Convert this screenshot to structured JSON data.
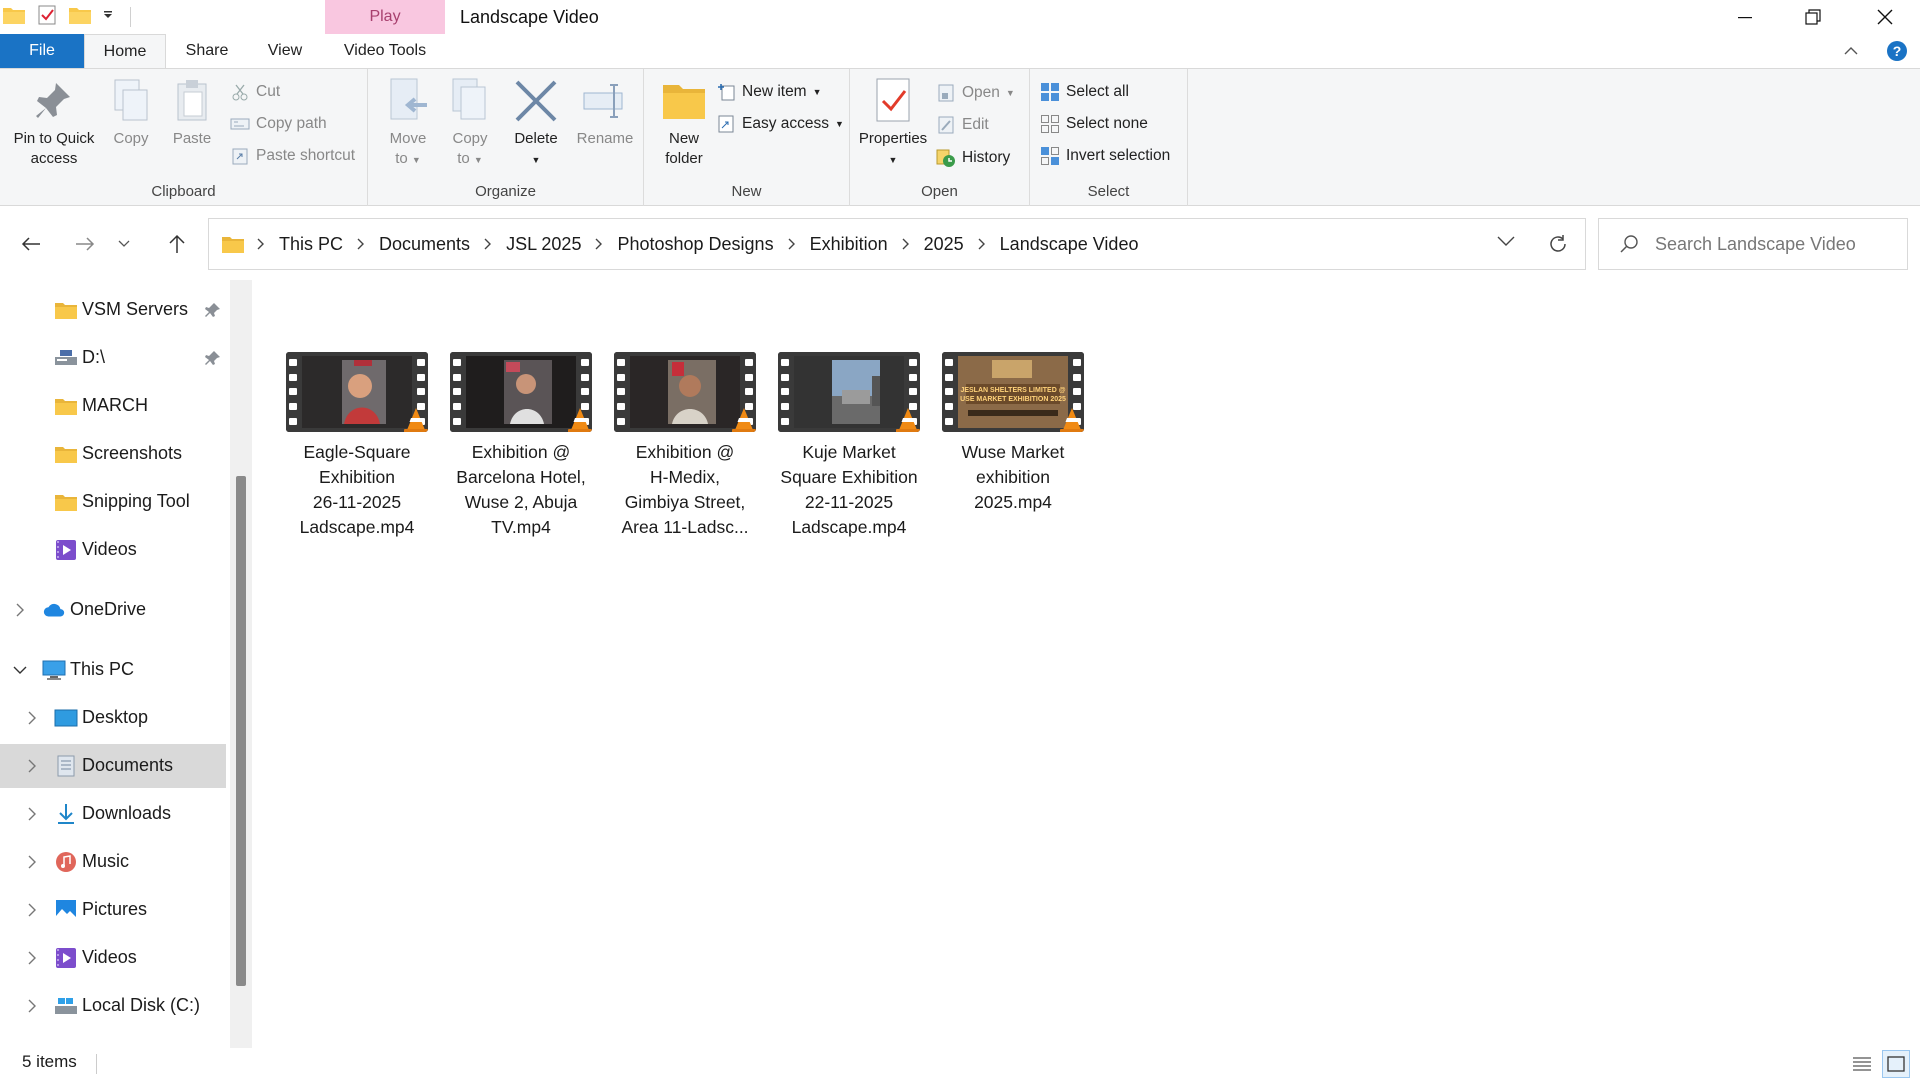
{
  "window": {
    "title": "Landscape Video",
    "contextual_tab": "Play"
  },
  "tabs": {
    "file": "File",
    "home": "Home",
    "share": "Share",
    "view": "View",
    "video_tools": "Video Tools"
  },
  "ribbon": {
    "clipboard": {
      "label": "Clipboard",
      "pin": "Pin to Quick access",
      "pin_line1": "Pin to Quick",
      "pin_line2": "access",
      "copy": "Copy",
      "paste": "Paste",
      "cut": "Cut",
      "copy_path": "Copy path",
      "paste_shortcut": "Paste shortcut"
    },
    "organize": {
      "label": "Organize",
      "move_line1": "Move",
      "move_line2": "to",
      "copy_line1": "Copy",
      "copy_line2": "to",
      "delete": "Delete",
      "rename": "Rename"
    },
    "new": {
      "label": "New",
      "new_folder_line1": "New",
      "new_folder_line2": "folder",
      "new_item": "New item",
      "easy_access": "Easy access"
    },
    "open": {
      "label": "Open",
      "properties": "Properties",
      "open": "Open",
      "edit": "Edit",
      "history": "History"
    },
    "select": {
      "label": "Select",
      "select_all": "Select all",
      "select_none": "Select none",
      "invert": "Invert selection"
    }
  },
  "address": {
    "crumbs": [
      "This PC",
      "Documents",
      "JSL 2025",
      "Photoshop Designs",
      "Exhibition",
      "2025",
      "Landscape Video"
    ],
    "search_placeholder": "Search Landscape Video"
  },
  "nav": {
    "items": [
      {
        "label": "VSM Servers",
        "icon": "folder-icon",
        "pinned": true
      },
      {
        "label": "D:\\",
        "icon": "drive-icon",
        "pinned": true
      },
      {
        "label": "MARCH",
        "icon": "folder-icon"
      },
      {
        "label": "Screenshots",
        "icon": "folder-icon"
      },
      {
        "label": "Snipping Tool",
        "icon": "folder-icon"
      },
      {
        "label": "Videos",
        "icon": "videos-icon"
      },
      {
        "label": "OneDrive",
        "icon": "onedrive-icon"
      },
      {
        "label": "This PC",
        "icon": "pc-icon"
      },
      {
        "label": "Desktop",
        "icon": "desktop-icon"
      },
      {
        "label": "Documents",
        "icon": "documents-icon",
        "selected": true
      },
      {
        "label": "Downloads",
        "icon": "downloads-icon"
      },
      {
        "label": "Music",
        "icon": "music-icon"
      },
      {
        "label": "Pictures",
        "icon": "pictures-icon"
      },
      {
        "label": "Videos",
        "icon": "videos-icon"
      },
      {
        "label": "Local Disk (C:)",
        "icon": "local-disk-icon"
      }
    ]
  },
  "files": [
    {
      "l1": "Eagle-Square",
      "l2": "Exhibition",
      "l3": "26-11-2025",
      "l4": "Ladscape.mp4"
    },
    {
      "l1": "Exhibition @",
      "l2": "Barcelona Hotel,",
      "l3": "Wuse 2, Abuja",
      "l4": "TV.mp4"
    },
    {
      "l1": "Exhibition @",
      "l2": "H-Medix,",
      "l3": "Gimbiya Street,",
      "l4": "Area 11-Ladsc..."
    },
    {
      "l1": "Kuje Market",
      "l2": "Square Exhibition",
      "l3": "22-11-2025",
      "l4": "Ladscape.mp4"
    },
    {
      "l1": "Wuse Market",
      "l2": "exhibition",
      "l3": "2025.mp4",
      "l4": ""
    }
  ],
  "status": {
    "count": "5 items"
  },
  "colors": {
    "accent": "#1a73c5",
    "context_tab": "#f9c7e0",
    "folder": "#f8c84a",
    "selected_nav": "#d9d9d9"
  }
}
